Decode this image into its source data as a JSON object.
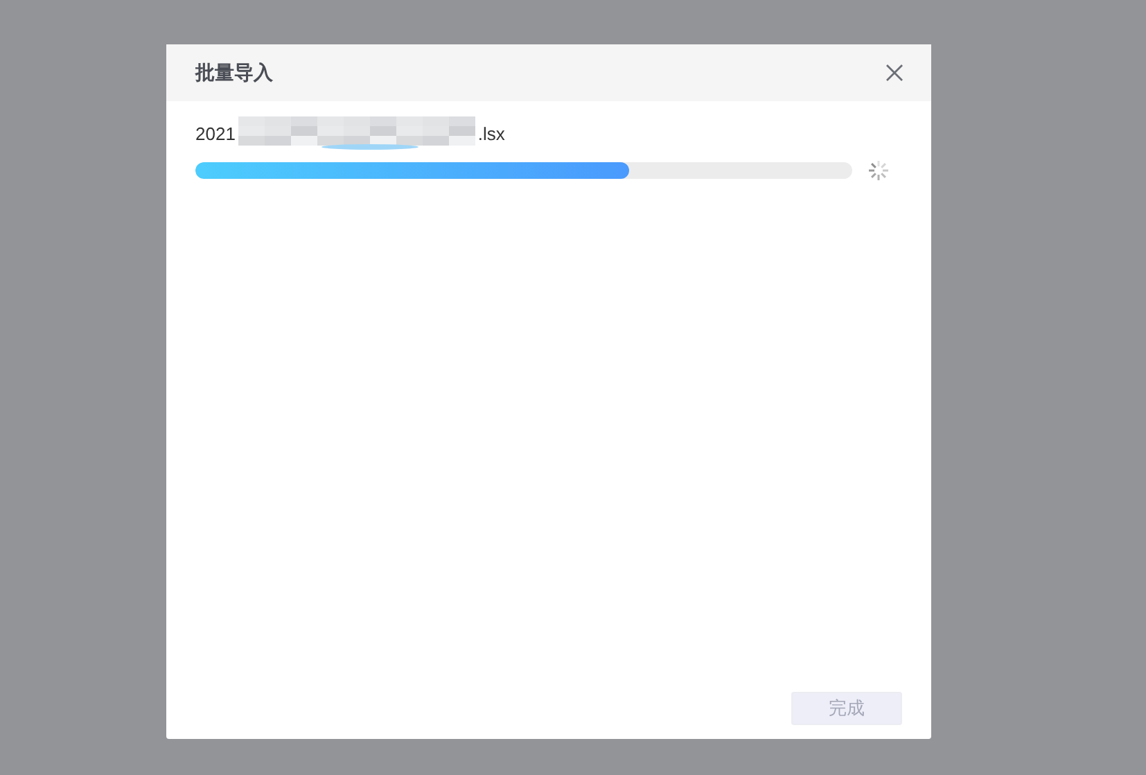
{
  "dialog": {
    "title": "批量导入",
    "file": {
      "name_start": "2021",
      "name_end": ".lsx",
      "level": 0.66,
      "loading": true
    },
    "buttons": [
      {
        "label": "完成",
        "disabled": true
      }
    ]
  }
}
